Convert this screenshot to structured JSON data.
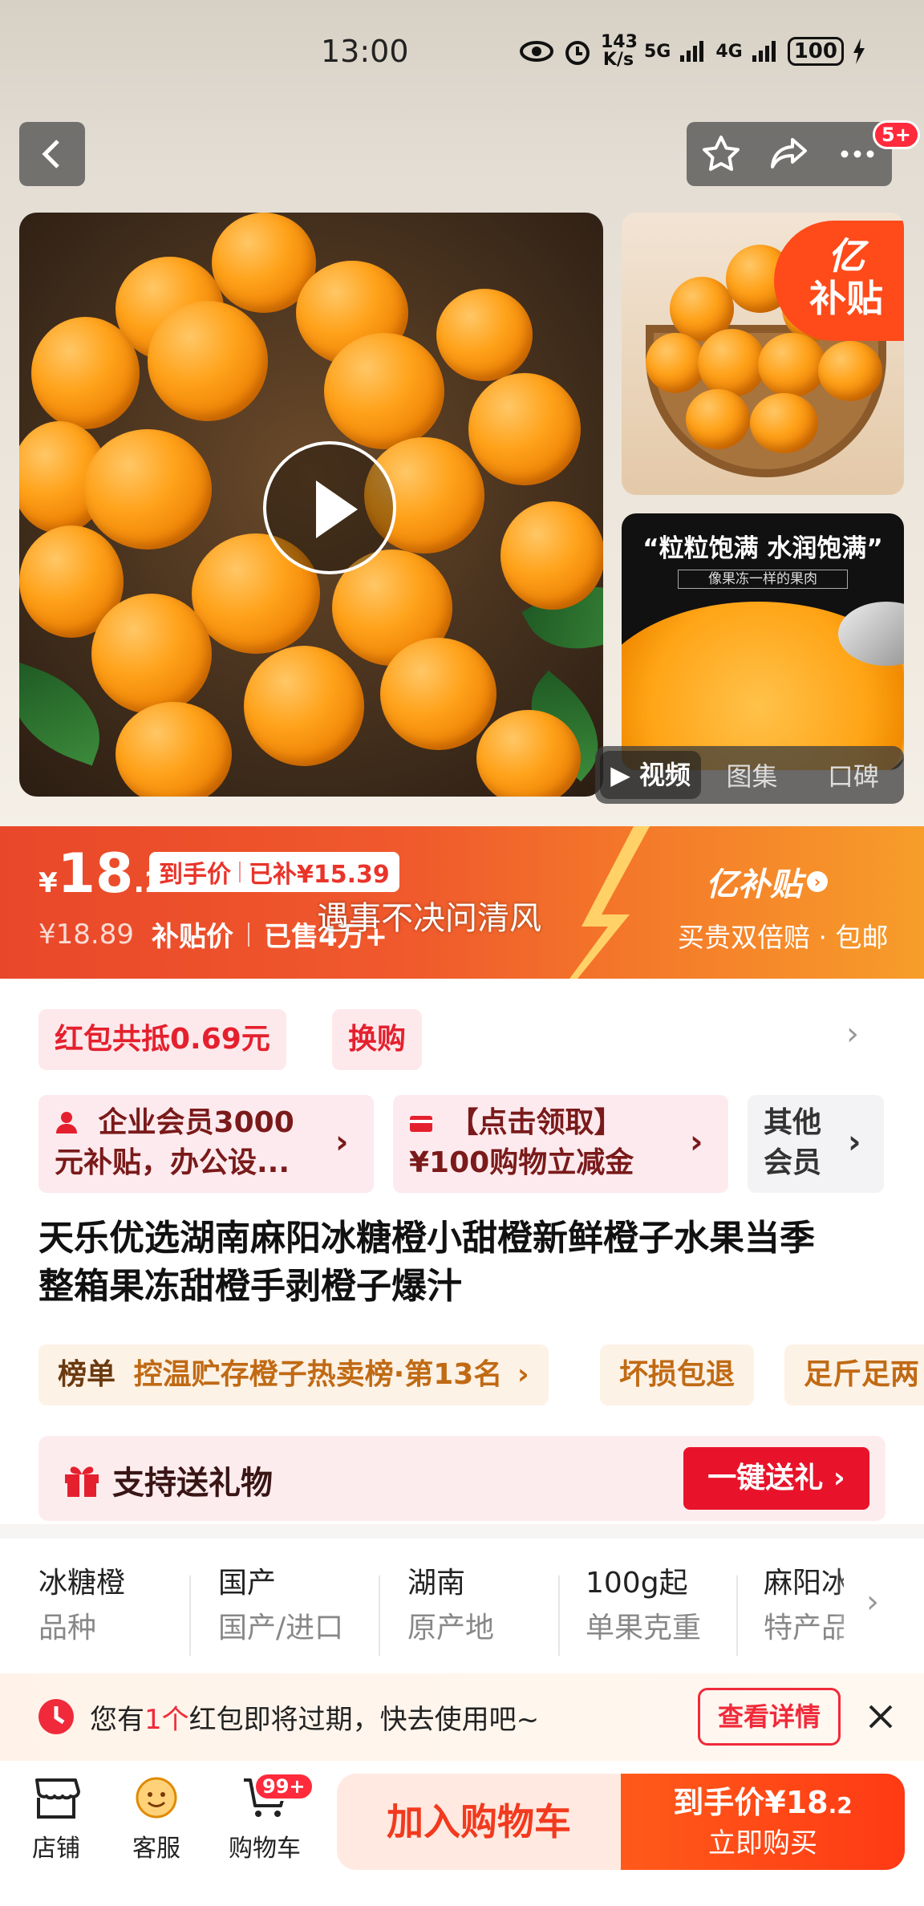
{
  "status": {
    "time": "13:00",
    "net_speed": "143 K/s",
    "sig1": "5G",
    "sig2": "4G",
    "battery": "100"
  },
  "nav": {
    "badge": "5+"
  },
  "gallery": {
    "thumb2_quote": "“粒粒饱满 水润饱满”",
    "thumb2_sub": "像果冻一样的果肉",
    "subsidy_badge": [
      "亿",
      "补贴"
    ],
    "tabs": [
      "视频",
      "图集",
      "口碑"
    ]
  },
  "price": {
    "currency": "¥",
    "int": "18",
    "dec": ".2",
    "tag_label": "到手价",
    "tag_sub": "已补¥15.39",
    "orig": "¥18.89",
    "label": "补贴价",
    "sold": "已售4万+",
    "overlay": "遇事不决问清风",
    "brand": "亿补贴",
    "brand_sub": "买贵双倍赔 · 包邮"
  },
  "coupons": {
    "c1": "红包共抵0.69元",
    "c2": "换购"
  },
  "members": {
    "m1_line1": "企业会员3000",
    "m1_line2": "元补贴，办公设...",
    "m2_line1": "【点击领取】",
    "m2_line2": "¥100购物立减金",
    "m3_line1": "其他",
    "m3_line2": "会员"
  },
  "title": {
    "line1": "天乐优选湖南麻阳冰糖橙小甜橙新鲜橙子水果当季",
    "line2": "整箱果冻甜橙手剥橙子爆汁"
  },
  "tags": {
    "rank_label": "榜单",
    "rank_text": "控温贮存橙子热卖榜·第13名",
    "t2": "坏损包退",
    "t3": "足斤足两"
  },
  "gift": {
    "label": "支持送礼物",
    "button": "一键送礼"
  },
  "attrs": [
    {
      "value": "冰糖橙",
      "key": "品种"
    },
    {
      "value": "国产",
      "key": "国产/进口"
    },
    {
      "value": "湖南",
      "key": "原产地"
    },
    {
      "value": "100g起",
      "key": "单果克重"
    },
    {
      "value": "麻阳冰",
      "key": "特产品"
    }
  ],
  "notice": {
    "pre": "您有",
    "num": "1个",
    "post": "红包即将过期，快去使用吧~",
    "button": "查看详情"
  },
  "bottom": {
    "shop": "店铺",
    "service": "客服",
    "cart": "购物车",
    "cart_badge": "99+",
    "add_cart": "加入购物车",
    "buy_line1_label": "到手价",
    "buy_line1_price": "¥18",
    "buy_line1_dec": ".2",
    "buy_line2": "立即购买"
  },
  "colors": {
    "accent": "#ff2a3b",
    "price_bar": "#f05a2c",
    "primary_btn": "#ff4d1a"
  }
}
